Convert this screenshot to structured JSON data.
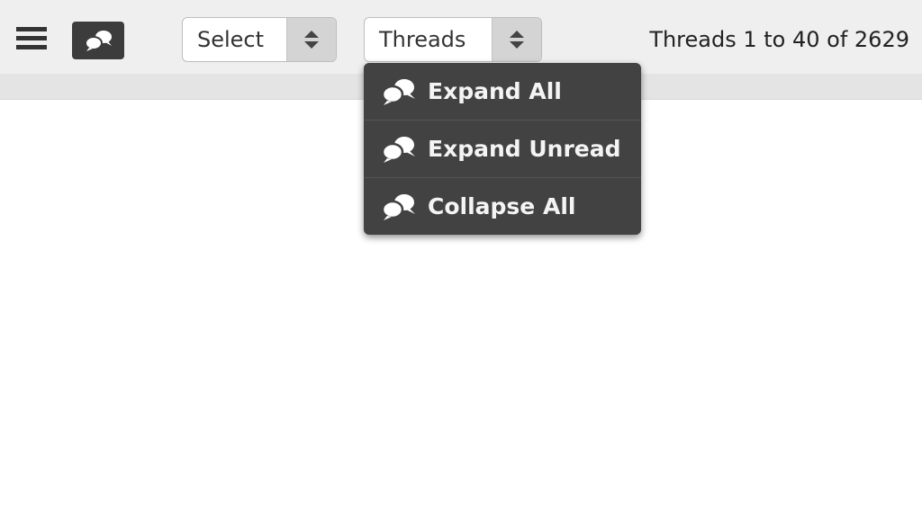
{
  "toolbar": {
    "menu_icon": "hamburger-icon",
    "conversation_icon": "speech-bubbles-icon",
    "select_dropdown": {
      "value": "Select",
      "icon": "up-down-arrows-icon"
    },
    "view_dropdown": {
      "value": "Threads",
      "icon": "up-down-arrows-icon"
    },
    "pagination": "Threads 1 to 40 of 2629"
  },
  "thread_menu": {
    "items": [
      {
        "label": "Expand All",
        "icon": "speech-bubbles-icon"
      },
      {
        "label": "Expand Unread",
        "icon": "speech-bubbles-icon"
      },
      {
        "label": "Collapse All",
        "icon": "speech-bubbles-icon"
      }
    ]
  },
  "colors": {
    "toolbar_bg": "#efefef",
    "menu_bg": "#424242",
    "menu_text": "#f4f4f4"
  }
}
